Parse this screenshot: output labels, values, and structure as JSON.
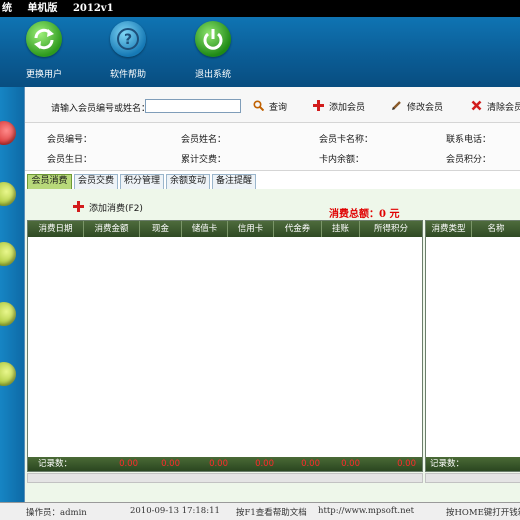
{
  "window": {
    "title_parts": [
      "统",
      "单机版",
      "2012v1"
    ]
  },
  "toolbar": {
    "switch_user": "更换用户",
    "help": "软件帮助",
    "exit": "退出系统"
  },
  "search": {
    "label": "请输入会员编号或姓名：",
    "value": "",
    "query_label": "查询",
    "add_member_label": "添加会员",
    "edit_member_label": "修改会员",
    "clear_member_label": "清除会员"
  },
  "member_info": {
    "id_label": "会员编号：",
    "name_label": "会员姓名：",
    "card_name_label": "会员卡名称：",
    "phone_label": "联系电话：",
    "birthday_label": "会员生日：",
    "total_spend_label": "累计交费：",
    "balance_label": "卡内余额：",
    "points_label": "会员积分："
  },
  "tabs": [
    "会员消费",
    "会员交费",
    "积分管理",
    "余额变动",
    "备注提醒"
  ],
  "consume": {
    "add_label": "添加消费(F2)",
    "total_label": "消费总额：",
    "total_value": "0 元"
  },
  "left_grid": {
    "columns": [
      "消费日期",
      "消费金额",
      "现金",
      "储值卡",
      "信用卡",
      "代金券",
      "挂账",
      "所得积分"
    ],
    "footer_label": "记录数：",
    "footer_values": [
      "0.00",
      "0.00",
      "0.00",
      "0.00",
      "0.00",
      "0.00",
      "0.00"
    ]
  },
  "right_grid": {
    "columns": [
      "消费类型",
      "名称"
    ],
    "footer_label": "记录数："
  },
  "status": {
    "operator": "操作员：admin",
    "datetime": "2010-09-13 17:18:11",
    "f1_hint": "按F1查看帮助文档",
    "url": "http://www.mpsoft.net",
    "drawer_hint": "按HOME键打开钱箱"
  },
  "colors": {
    "accent_blue": "#0b5a8c",
    "grid_header": "#3b5a2c",
    "total_red": "#e00000",
    "active_tab": "#b8d97a"
  },
  "icons": {
    "switch_user": "refresh-arrows-icon",
    "help": "question-mark-icon",
    "exit": "power-icon",
    "query": "magnifier-icon",
    "add": "plus-icon",
    "edit": "pen-icon",
    "clear": "delete-x-icon"
  }
}
